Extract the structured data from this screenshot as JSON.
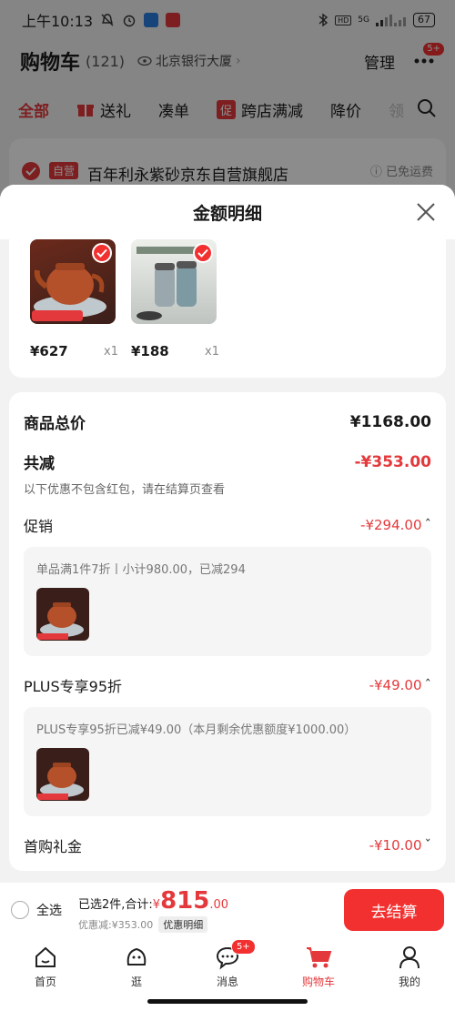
{
  "status_bar": {
    "time": "上午10:13",
    "network": "5G",
    "battery": "67"
  },
  "cart_header": {
    "title": "购物车",
    "count": "(121)",
    "location": "北京银行大厦",
    "manage": "管理",
    "more_badge": "5+"
  },
  "filter_tabs": [
    {
      "label": "全部"
    },
    {
      "label": "送礼"
    },
    {
      "label": "凑单"
    },
    {
      "label": "跨店满减",
      "tag": "促"
    },
    {
      "label": "降价"
    },
    {
      "label": "领"
    }
  ],
  "store": {
    "tag": "自营",
    "name": "百年利永紫砂京东自营旗舰店",
    "shipping": "已免运费"
  },
  "sheet": {
    "title": "金额明细",
    "products": [
      {
        "price": "¥627",
        "qty": "x1"
      },
      {
        "price": "¥188",
        "qty": "x1"
      }
    ],
    "goods_total_label": "商品总价",
    "goods_total_value": "¥1168.00",
    "reduce_label": "共减",
    "reduce_value": "-¥353.00",
    "reduce_note": "以下优惠不包含红包，请在结算页查看",
    "promo_label": "促销",
    "promo_value": "-¥294.00",
    "promo_detail": "单品满1件7折丨小计980.00，已减294",
    "plus_label": "PLUS专享95折",
    "plus_value": "-¥49.00",
    "plus_detail": "PLUS专享95折已减¥49.00（本月剩余优惠额度¥1000.00）",
    "gift_label": "首购礼金",
    "gift_value": "-¥10.00"
  },
  "checkout": {
    "select_all": "全选",
    "selected_prefix": "已选2件,合计:",
    "currency": "¥",
    "total_int": "815",
    "total_dec": ".00",
    "discount_text": "优惠减:¥353.00",
    "detail_pill": "优惠明细",
    "button": "去结算"
  },
  "tab_bar": {
    "home": "首页",
    "browse": "逛",
    "messages": "消息",
    "messages_badge": "5+",
    "cart": "购物车",
    "me": "我的"
  },
  "colors": {
    "accent": "#e4393c",
    "button": "#f23030"
  }
}
